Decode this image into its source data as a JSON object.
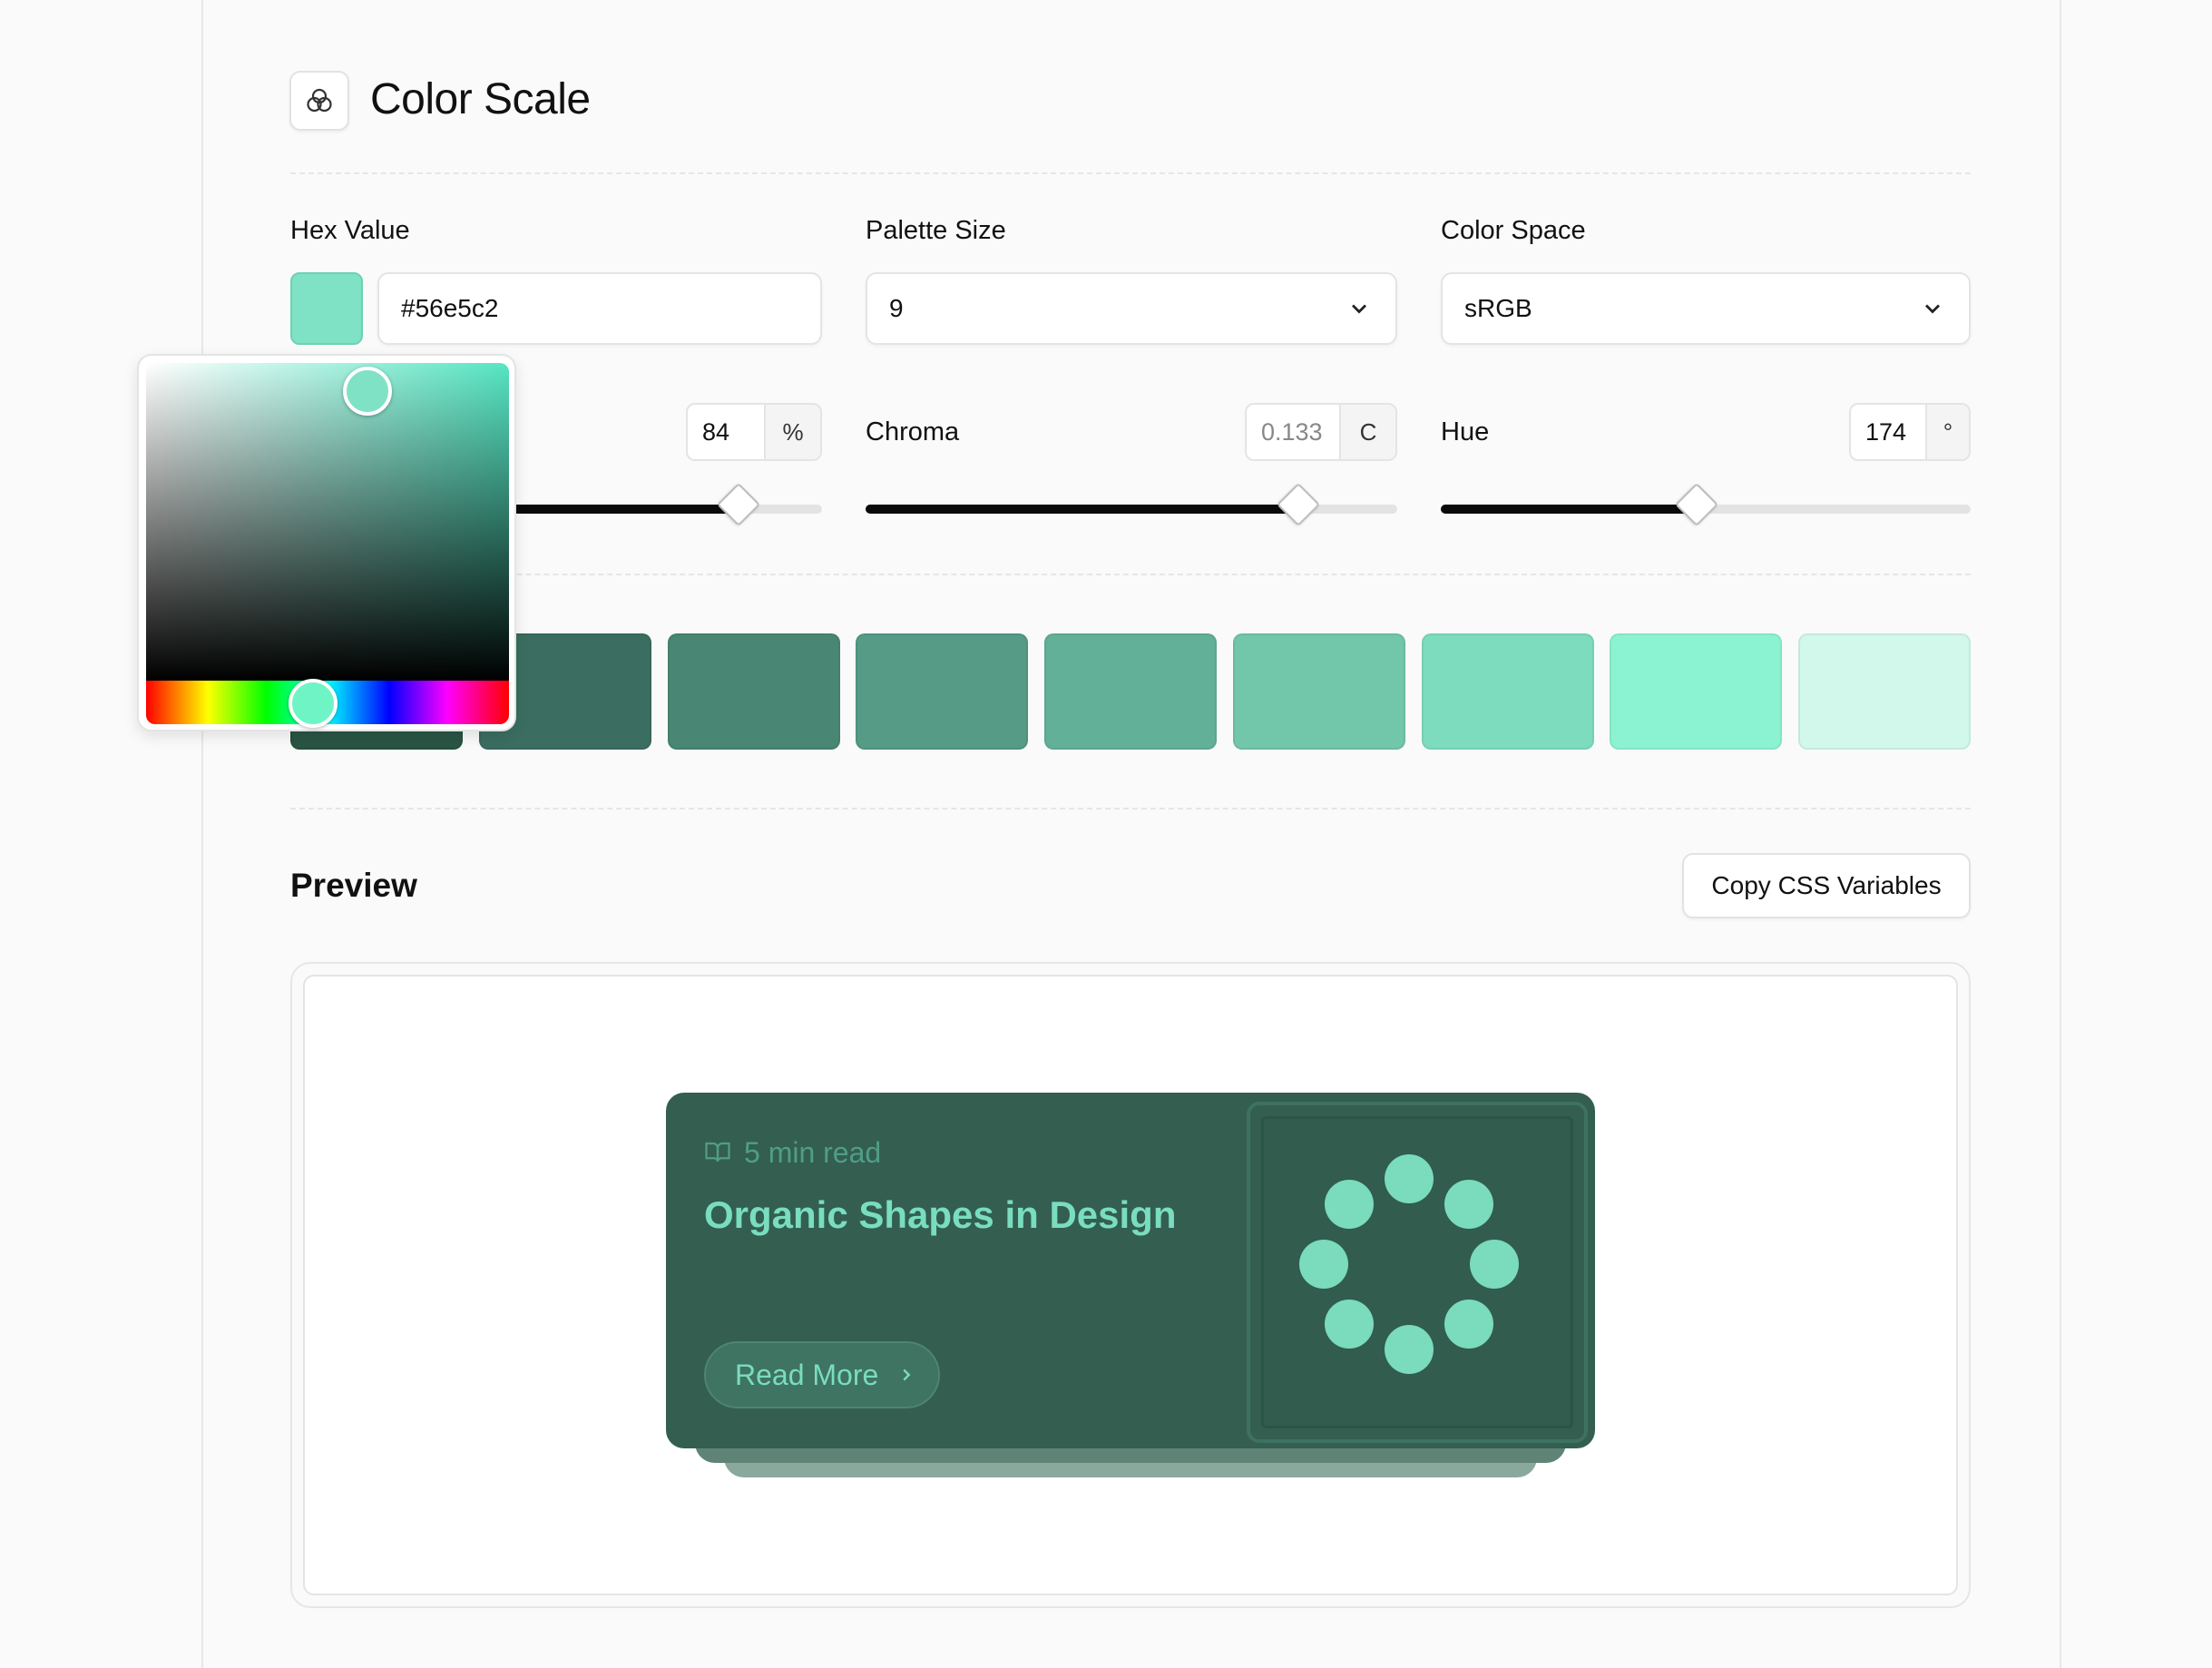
{
  "header": {
    "title": "Color Scale",
    "icon": "color-circles-icon"
  },
  "controls": {
    "hex": {
      "label": "Hex Value",
      "value": "#56e5c2",
      "swatch_color": "#80e2c5"
    },
    "palette_size": {
      "label": "Palette Size",
      "value": "9"
    },
    "color_space": {
      "label": "Color Space",
      "value": "sRGB"
    },
    "lightness": {
      "value": "84",
      "unit": "%",
      "slider_fraction": 0.84
    },
    "chroma": {
      "label": "Chroma",
      "value": "0.133",
      "unit": "C",
      "slider_fraction": 0.81
    },
    "hue": {
      "label": "Hue",
      "value": "174",
      "unit": "°",
      "slider_fraction": 0.48
    }
  },
  "palette": {
    "swatches": [
      "#295545",
      "#3b6e60",
      "#4a8674",
      "#559b86",
      "#62b098",
      "#72c6aa",
      "#7ddcbe",
      "#8cf3d2",
      "#d1f8ea"
    ]
  },
  "preview": {
    "title": "Preview",
    "copy_button": "Copy CSS Variables",
    "card": {
      "meta": "5 min read",
      "meta_icon": "book-open-icon",
      "title": "Organic Shapes in Design",
      "cta": "Read More",
      "cta_icon": "chevron-right-icon"
    }
  },
  "picker": {
    "base_color": "#56e5c2"
  }
}
